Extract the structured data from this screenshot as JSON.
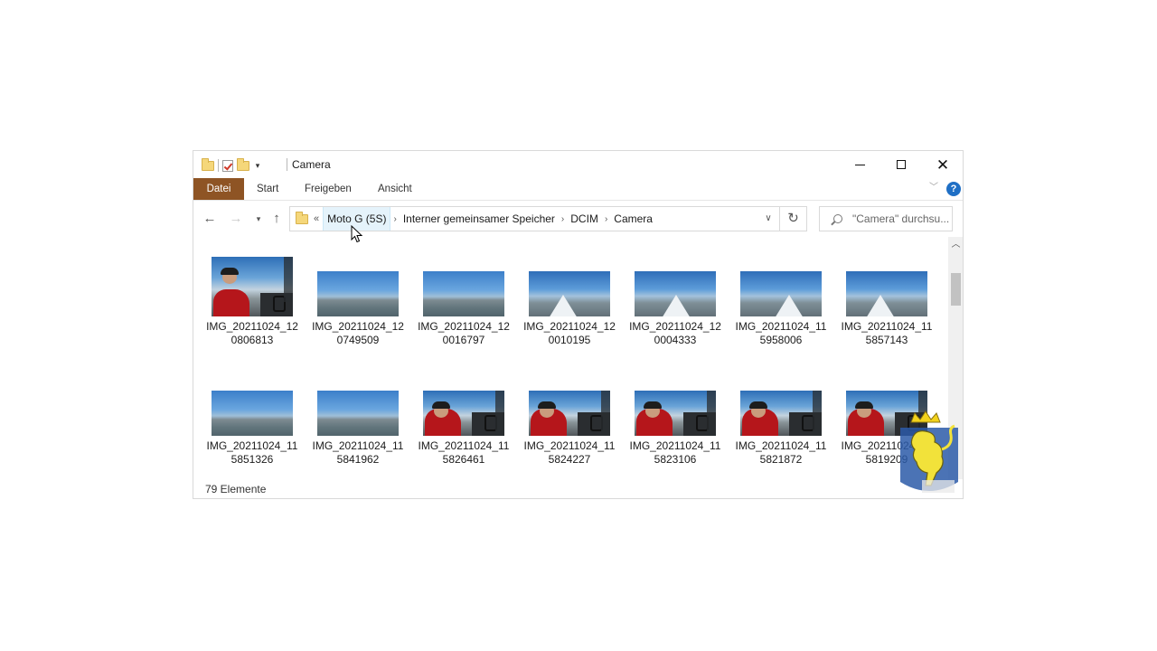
{
  "window": {
    "title": "Camera",
    "minimize_label": "—",
    "close_label": "✕"
  },
  "ribbon": {
    "tabs": [
      {
        "label": "Datei",
        "active": true
      },
      {
        "label": "Start"
      },
      {
        "label": "Freigeben"
      },
      {
        "label": "Ansicht"
      }
    ],
    "help_label": "?"
  },
  "nav": {
    "back_icon": "arrow-left-icon",
    "forward_icon": "arrow-right-icon",
    "up_icon": "arrow-up-icon",
    "overflow_label": "«",
    "breadcrumbs": [
      {
        "label": "Moto G (5S)"
      },
      {
        "label": "Interner gemeinsamer Speicher"
      },
      {
        "label": "DCIM"
      },
      {
        "label": "Camera"
      }
    ],
    "crumb_separator": "›",
    "refresh_icon": "refresh-icon"
  },
  "search": {
    "placeholder": "\"Camera\" durchsu..."
  },
  "files": [
    {
      "line1": "IMG_20211024_12",
      "line2": "0806813",
      "thumb": "pilot"
    },
    {
      "line1": "IMG_20211024_12",
      "line2": "0749509",
      "thumb": "sky"
    },
    {
      "line1": "IMG_20211024_12",
      "line2": "0016797",
      "thumb": "sky"
    },
    {
      "line1": "IMG_20211024_12",
      "line2": "0010195",
      "thumb": "wing"
    },
    {
      "line1": "IMG_20211024_12",
      "line2": "0004333",
      "thumb": "wing"
    },
    {
      "line1": "IMG_20211024_11",
      "line2": "5958006",
      "thumb": "wing"
    },
    {
      "line1": "IMG_20211024_11",
      "line2": "5857143",
      "thumb": "wing"
    },
    {
      "line1": "IMG_20211024_11",
      "line2": "5851326",
      "thumb": "sky"
    },
    {
      "line1": "IMG_20211024_11",
      "line2": "5841962",
      "thumb": "sky"
    },
    {
      "line1": "IMG_20211024_11",
      "line2": "5826461",
      "thumb": "pilot"
    },
    {
      "line1": "IMG_20211024_11",
      "line2": "5824227",
      "thumb": "pilot"
    },
    {
      "line1": "IMG_20211024_11",
      "line2": "5823106",
      "thumb": "pilot"
    },
    {
      "line1": "IMG_20211024_11",
      "line2": "5821872",
      "thumb": "pilot"
    },
    {
      "line1": "IMG_20211024_11",
      "line2": "5819209",
      "thumb": "pilot"
    }
  ],
  "status": {
    "count": "79 Elemente"
  },
  "colors": {
    "datei_tab": "#8e5424",
    "help": "#1f6fc5",
    "crumb_highlight": "#e5f3fb"
  }
}
